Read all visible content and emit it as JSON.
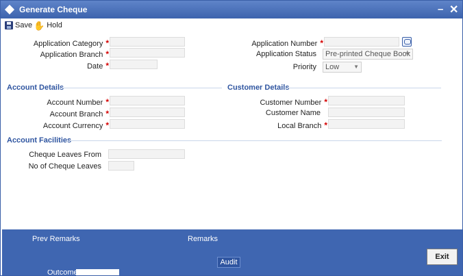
{
  "window": {
    "title": "Generate Cheque",
    "minimize_glyph": "–",
    "close_glyph": "✕"
  },
  "toolbar": {
    "save_label": "Save",
    "hold_label": "Hold"
  },
  "header": {
    "application_category_label": "Application Category",
    "application_branch_label": "Application Branch",
    "date_label": "Date",
    "application_number_label": "Application Number",
    "application_status_label": "Application Status",
    "application_status_value": "Pre-printed Cheque Book",
    "priority_label": "Priority",
    "priority_value": "Low"
  },
  "account_details": {
    "title": "Account Details",
    "account_number_label": "Account Number",
    "account_branch_label": "Account Branch",
    "account_currency_label": "Account Currency"
  },
  "customer_details": {
    "title": "Customer Details",
    "customer_number_label": "Customer Number",
    "customer_name_label": "Customer Name",
    "local_branch_label": "Local Branch"
  },
  "account_facilities": {
    "title": "Account Facilities",
    "cheque_leaves_from_label": "Cheque Leaves From",
    "no_of_cheque_leaves_label": "No of Cheque Leaves"
  },
  "footer": {
    "prev_remarks_label": "Prev Remarks",
    "remarks_label": "Remarks",
    "audit_label": "Audit",
    "outcome_label": "Outcome",
    "exit_label": "Exit"
  },
  "colors": {
    "title_bar": "#3c63ad",
    "footer": "#3f66b1",
    "section_title": "#2f55a0",
    "required": "#d40000"
  },
  "icons": [
    "diamond-icon",
    "save-icon",
    "hold-icon",
    "lookup-icon",
    "chevron-down-icon"
  ]
}
